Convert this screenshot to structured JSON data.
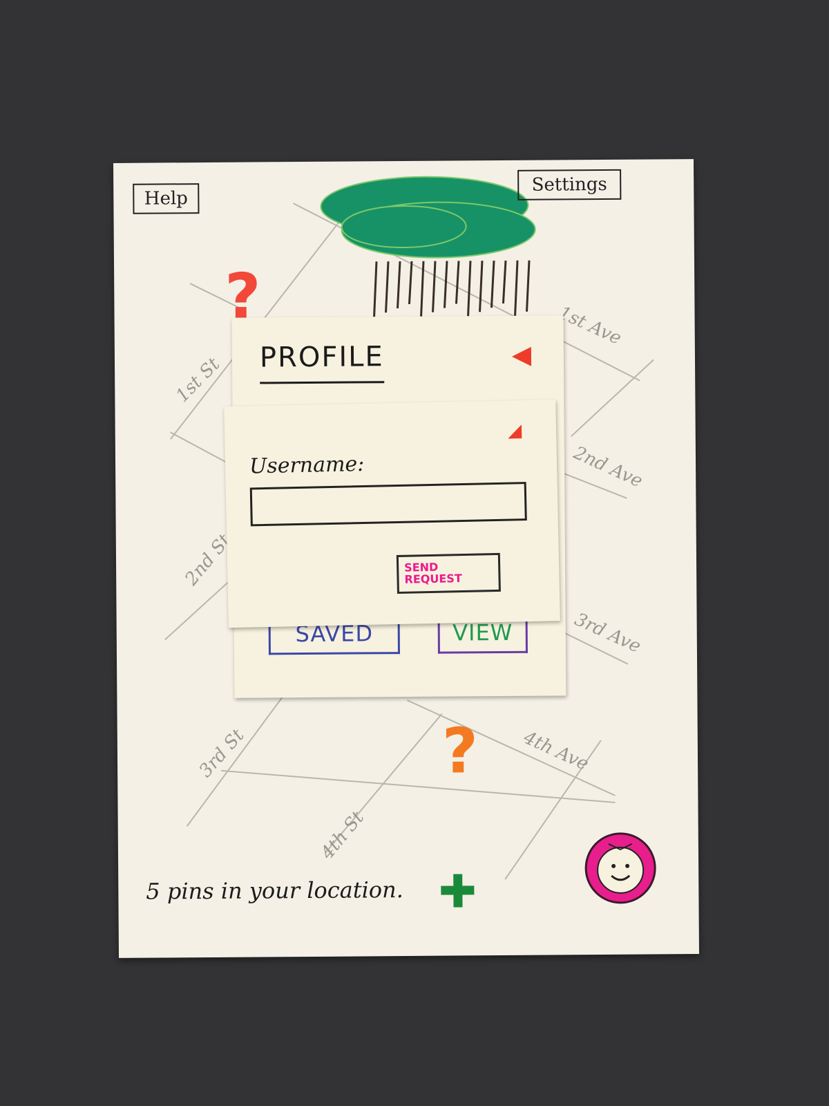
{
  "toolbar": {
    "help_label": "Help",
    "settings_label": "Settings"
  },
  "map": {
    "streets": [
      "1st St",
      "2nd St",
      "3rd St",
      "4th St"
    ],
    "avenues": [
      "1st Ave",
      "2nd Ave",
      "3rd Ave",
      "4th Ave"
    ],
    "pin_glyph": "?",
    "pin_colors": [
      "#f2483a",
      "#f47a22"
    ],
    "tree_color": "#179266"
  },
  "profile_panel": {
    "title": "PROFILE",
    "collapse_color": "#ef3b2a",
    "buttons": [
      {
        "label": "SAVED",
        "color": "#3b47a8"
      },
      {
        "label": "VIEW",
        "color": "#1f9a4f",
        "border": "#6a3aa4"
      }
    ]
  },
  "request_panel": {
    "username_label": "Username:",
    "username_value": "",
    "send_label": "SEND REQUEST",
    "send_color": "#ec1a8e"
  },
  "footer": {
    "pins_text": "5 pins in your location.",
    "add_icon_color": "#1a8a3a",
    "avatar_color": "#e81e8c"
  }
}
